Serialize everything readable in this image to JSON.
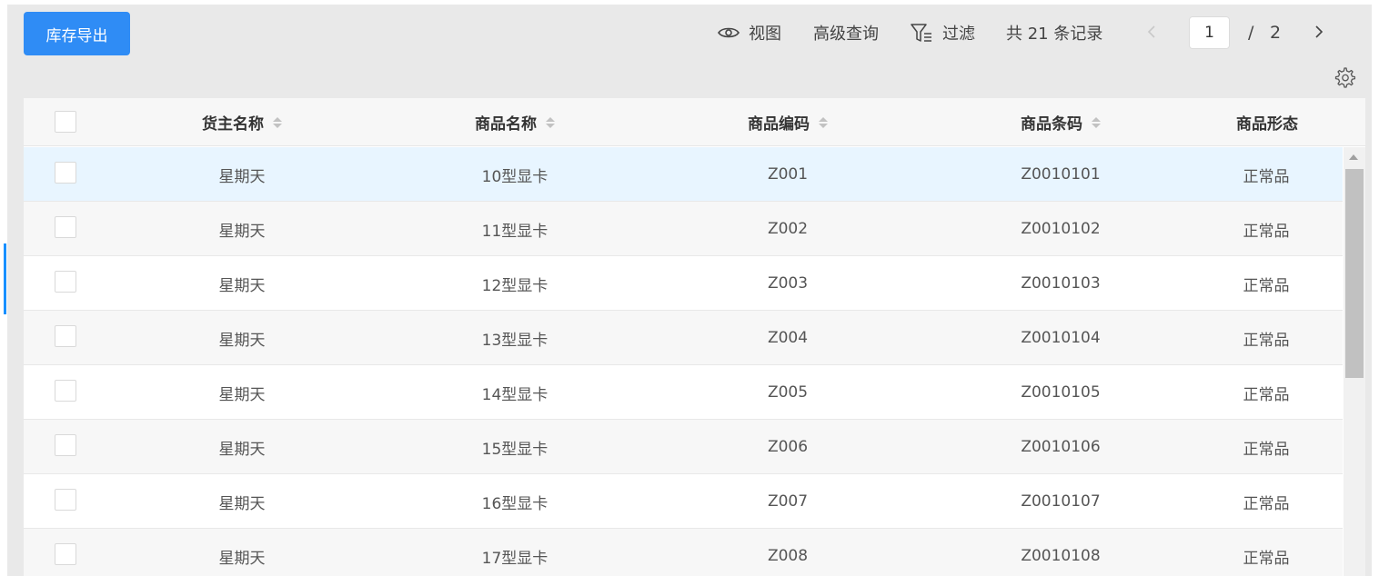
{
  "toolbar": {
    "export_label": "库存导出",
    "view_label": "视图",
    "advanced_query_label": "高级查询",
    "filter_label": "过滤",
    "total_text": "共 21 条记录"
  },
  "pagination": {
    "current_page": "1",
    "separator": "/",
    "total_pages": "2"
  },
  "table": {
    "columns": [
      {
        "label": "货主名称",
        "sortable": true
      },
      {
        "label": "商品名称",
        "sortable": true
      },
      {
        "label": "商品编码",
        "sortable": true
      },
      {
        "label": "商品条码",
        "sortable": true
      },
      {
        "label": "商品形态",
        "sortable": false
      }
    ],
    "rows": [
      {
        "owner": "星期天",
        "product_name": "10型显卡",
        "product_code": "Z001",
        "barcode": "Z0010101",
        "form": "正常品"
      },
      {
        "owner": "星期天",
        "product_name": "11型显卡",
        "product_code": "Z002",
        "barcode": "Z0010102",
        "form": "正常品"
      },
      {
        "owner": "星期天",
        "product_name": "12型显卡",
        "product_code": "Z003",
        "barcode": "Z0010103",
        "form": "正常品"
      },
      {
        "owner": "星期天",
        "product_name": "13型显卡",
        "product_code": "Z004",
        "barcode": "Z0010104",
        "form": "正常品"
      },
      {
        "owner": "星期天",
        "product_name": "14型显卡",
        "product_code": "Z005",
        "barcode": "Z0010105",
        "form": "正常品"
      },
      {
        "owner": "星期天",
        "product_name": "15型显卡",
        "product_code": "Z006",
        "barcode": "Z0010106",
        "form": "正常品"
      },
      {
        "owner": "星期天",
        "product_name": "16型显卡",
        "product_code": "Z007",
        "barcode": "Z0010107",
        "form": "正常品"
      },
      {
        "owner": "星期天",
        "product_name": "17型显卡",
        "product_code": "Z008",
        "barcode": "Z0010108",
        "form": "正常品"
      }
    ]
  },
  "colors": {
    "accent": "#2f8cf5",
    "highlight_row": "#e8f5ff"
  },
  "icons": [
    "eye-icon",
    "filter-icon",
    "chevron-left-icon",
    "chevron-right-icon",
    "gear-icon",
    "sort-icon"
  ]
}
